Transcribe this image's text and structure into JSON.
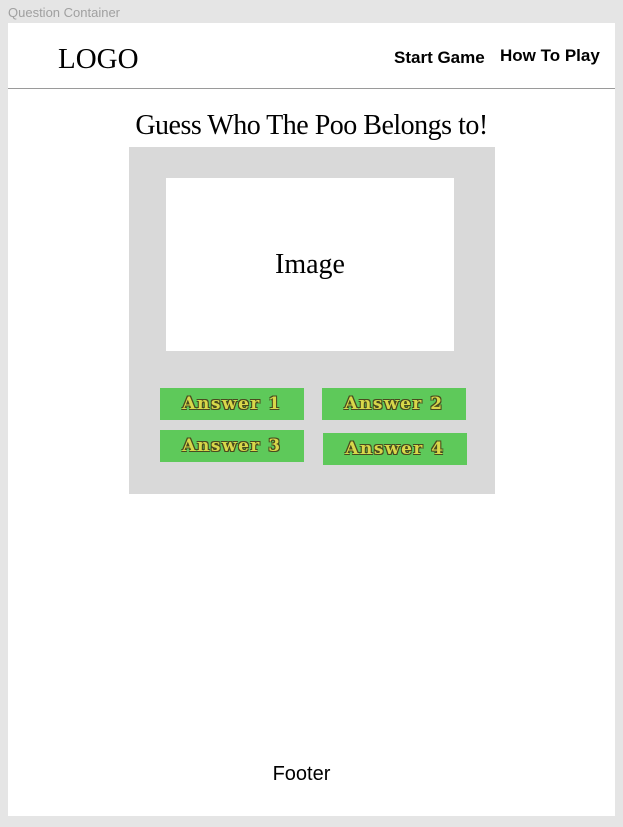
{
  "frame": {
    "label": "Question Container"
  },
  "header": {
    "logo": "LOGO",
    "nav": {
      "start_game": "Start Game",
      "how_to_play": "How To Play"
    }
  },
  "question": {
    "title": "Guess Who The Poo Belongs to!",
    "image_placeholder": "Image",
    "answers": [
      "Answer 1",
      "Answer 2",
      "Answer 3",
      "Answer 4"
    ]
  },
  "footer": {
    "text": "Footer"
  },
  "colors": {
    "page_background": "#e5e5e5",
    "card_background": "#d9d9d9",
    "answer_background": "#5ec95a",
    "answer_text": "#d8d84a"
  }
}
